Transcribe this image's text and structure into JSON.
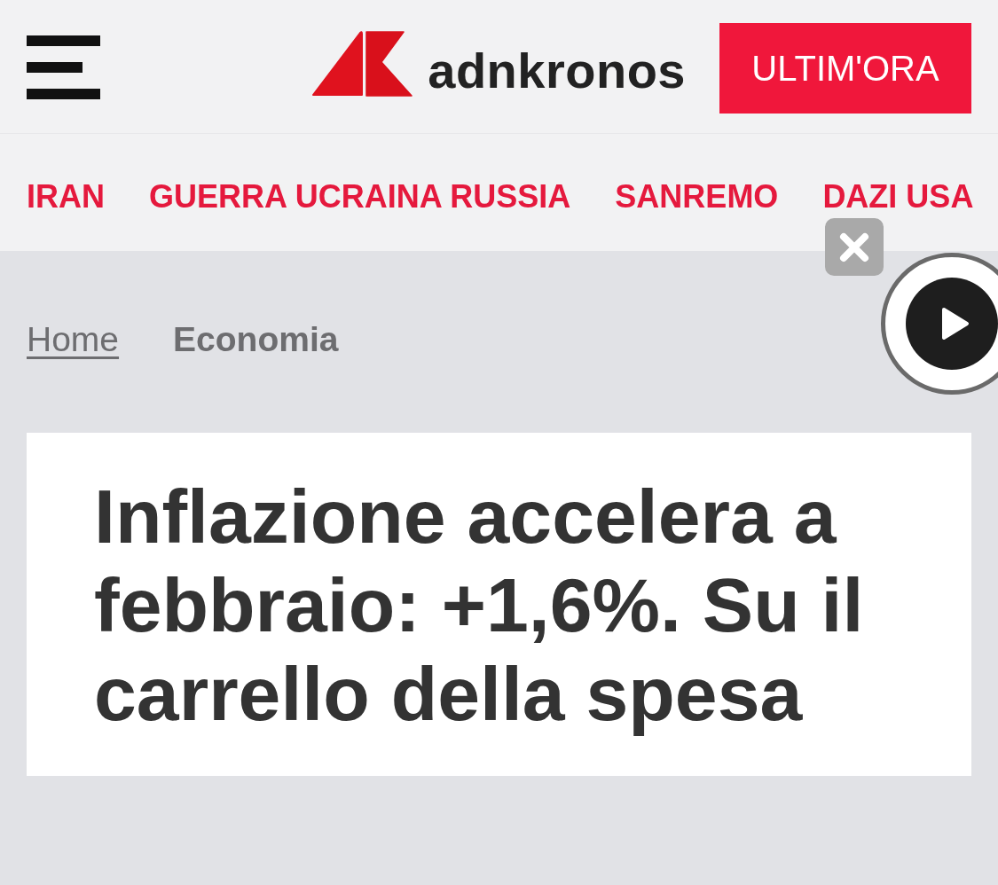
{
  "header": {
    "logo_text": "adnkronos",
    "breaking_button": "ULTIM'ORA"
  },
  "nav": {
    "items": [
      "IRAN",
      "GUERRA UCRAINA RUSSIA",
      "SANREMO",
      "DAZI USA"
    ]
  },
  "breadcrumb": [
    {
      "label": "Home",
      "kind": "link"
    },
    {
      "label": "Economia",
      "kind": "current"
    }
  ],
  "article": {
    "title": "Inflazione accelera a febbraio: +1,6%. Su il carrello della spesa"
  }
}
